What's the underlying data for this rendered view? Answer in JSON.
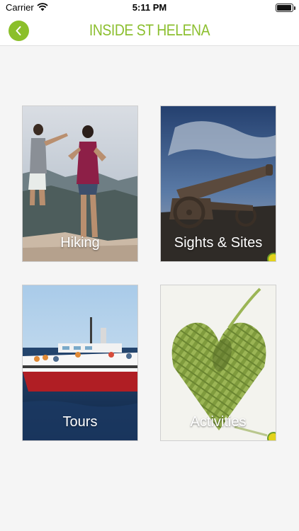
{
  "status_bar": {
    "carrier": "Carrier",
    "time": "5:11 PM",
    "wifi_icon": "wifi-icon",
    "battery_icon": "battery-icon"
  },
  "nav": {
    "title": "INSIDE ST HELENA",
    "back_icon": "chevron-left-icon",
    "accent_color": "#8cbf2f"
  },
  "tiles": [
    {
      "label": "Hiking",
      "image": "two hikers on a rocky summit"
    },
    {
      "label": "Sights & Sites",
      "image": "old iron cannon at dusk"
    },
    {
      "label": "Tours",
      "image": "red and white tour boat on the sea"
    },
    {
      "label": "Activities",
      "image": "woven green flax heart"
    }
  ]
}
